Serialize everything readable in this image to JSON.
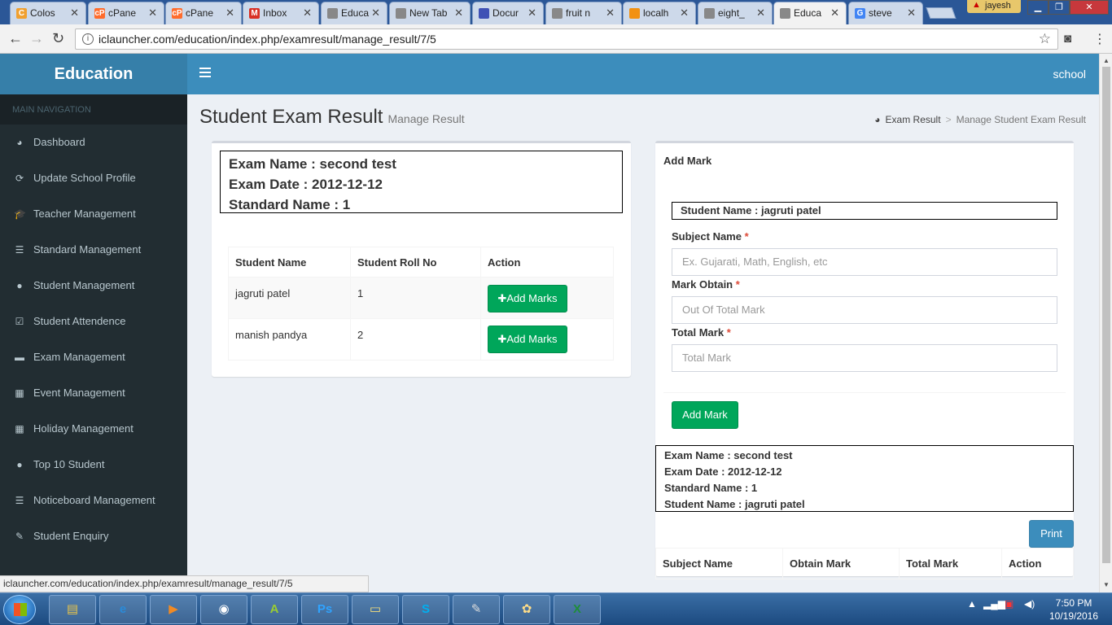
{
  "browser": {
    "tabs": [
      {
        "label": "Colos",
        "fav": "C",
        "fav_color": "#f0a030"
      },
      {
        "label": "cPane",
        "fav": "cP",
        "fav_color": "#ff6c2c"
      },
      {
        "label": "cPane",
        "fav": "cP",
        "fav_color": "#ff6c2c"
      },
      {
        "label": "Inbox",
        "fav": "M",
        "fav_color": "#d93025"
      },
      {
        "label": "Educa",
        "fav": "",
        "fav_color": "#888888"
      },
      {
        "label": "New Tab",
        "fav": "",
        "fav_color": "#888888"
      },
      {
        "label": "Docur",
        "fav": "",
        "fav_color": "#3f51b5"
      },
      {
        "label": "fruit n",
        "fav": "",
        "fav_color": "#888888"
      },
      {
        "label": "localh",
        "fav": "",
        "fav_color": "#f29111"
      },
      {
        "label": "eight_",
        "fav": "",
        "fav_color": "#888888"
      },
      {
        "label": "Educa",
        "fav": "",
        "fav_color": "#888888",
        "active": true
      },
      {
        "label": "steve",
        "fav": "G",
        "fav_color": "#4285f4"
      }
    ],
    "profile_name": "jayesh",
    "url": "iclauncher.com/education/index.php/examresult/manage_result/7/5",
    "status_url": "iclauncher.com/education/index.php/examresult/manage_result/7/5"
  },
  "app": {
    "brand": "Education",
    "user": "school",
    "sidebar_header": "MAIN NAVIGATION",
    "nav": [
      {
        "label": "Dashboard",
        "icon": "dashboard-icon",
        "glyph": "◕"
      },
      {
        "label": "Update School Profile",
        "icon": "refresh-icon",
        "glyph": "⟳"
      },
      {
        "label": "Teacher Management",
        "icon": "graduation-cap-icon",
        "glyph": "🎓"
      },
      {
        "label": "Standard Management",
        "icon": "list-icon",
        "glyph": "☰"
      },
      {
        "label": "Student Management",
        "icon": "user-icon",
        "glyph": "●"
      },
      {
        "label": "Student Attendence",
        "icon": "calendar-check-icon",
        "glyph": "☑"
      },
      {
        "label": "Exam Management",
        "icon": "briefcase-icon",
        "glyph": "▬"
      },
      {
        "label": "Event Management",
        "icon": "calendar-icon",
        "glyph": "▦"
      },
      {
        "label": "Holiday Management",
        "icon": "calendar-icon",
        "glyph": "▦"
      },
      {
        "label": "Top 10 Student",
        "icon": "user-icon",
        "glyph": "●"
      },
      {
        "label": "Noticeboard Management",
        "icon": "list-icon",
        "glyph": "☰"
      },
      {
        "label": "Student Enquiry",
        "icon": "edit-icon",
        "glyph": "✎"
      }
    ]
  },
  "content": {
    "title": "Student Exam Result",
    "subtitle": "Manage Result",
    "breadcrumb": {
      "home": "Exam Result",
      "current": "Manage Student Exam Result"
    },
    "exam_info": {
      "exam_name": "Exam Name : second test",
      "exam_date": "Exam Date : 2012-12-12",
      "standard_name": "Standard Name : 1"
    },
    "students_table": {
      "headers": [
        "Student Name",
        "Student Roll No",
        "Action"
      ],
      "rows": [
        {
          "name": "jagruti patel",
          "roll": "1",
          "action": "Add Marks"
        },
        {
          "name": "manish pandya",
          "roll": "2",
          "action": "Add Marks"
        }
      ]
    },
    "add_mark": {
      "title": "Add Mark",
      "student_name": "Student Name : jagruti patel",
      "subject_label": "Subject Name",
      "subject_placeholder": "Ex. Gujarati, Math, English, etc",
      "obtain_label": "Mark Obtain",
      "obtain_placeholder": "Out Of Total Mark",
      "total_label": "Total Mark",
      "total_placeholder": "Total Mark",
      "required_mark": "*",
      "submit": "Add Mark"
    },
    "result_info": {
      "exam_name": "Exam Name : second test",
      "exam_date": "Exam Date : 2012-12-12",
      "standard_name": "Standard Name : 1",
      "student_name": "Student Name : jagruti patel"
    },
    "print_label": "Print",
    "marks_table": {
      "headers": [
        "Subject Name",
        "Obtain Mark",
        "Total Mark",
        "Action"
      ]
    }
  },
  "taskbar": {
    "time": "7:50 PM",
    "date": "10/19/2016",
    "items": [
      {
        "name": "file-explorer",
        "glyph": "▤"
      },
      {
        "name": "internet-explorer",
        "glyph": "e"
      },
      {
        "name": "media-player",
        "glyph": "▶"
      },
      {
        "name": "chrome",
        "glyph": "◉"
      },
      {
        "name": "android-studio",
        "glyph": "A"
      },
      {
        "name": "photoshop",
        "glyph": "Ps"
      },
      {
        "name": "sticky-notes",
        "glyph": "▭"
      },
      {
        "name": "skype",
        "glyph": "S"
      },
      {
        "name": "notepad",
        "glyph": "✎"
      },
      {
        "name": "paint",
        "glyph": "✿"
      },
      {
        "name": "excel",
        "glyph": "X"
      }
    ]
  }
}
